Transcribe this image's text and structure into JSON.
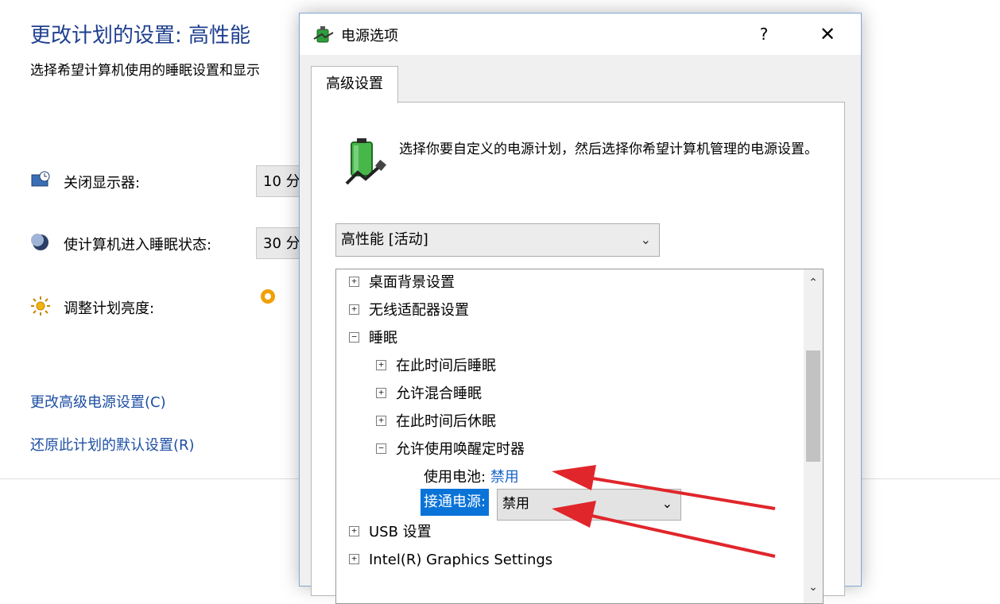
{
  "background_panel": {
    "title": "更改计划的设置: 高性能",
    "description": "选择希望计算机使用的睡眠设置和显示",
    "rows": [
      {
        "label": "关闭显示器:",
        "value": "10 分",
        "icon": "monitor-icon"
      },
      {
        "label": "使计算机进入睡眠状态:",
        "value": "30 分",
        "icon": "moon-icon"
      },
      {
        "label": "调整计划亮度:",
        "icon": "sun-icon"
      }
    ],
    "links": [
      "更改高级电源设置(C)",
      "还原此计划的默认设置(R)"
    ]
  },
  "dialog": {
    "title": "电源选项",
    "help": "?",
    "close": "✕",
    "tab": "高级设置",
    "description": "选择你要自定义的电源计划，然后选择你希望计算机管理的电源设置。",
    "plan_select": "高性能 [活动]",
    "tree": {
      "nodes": [
        {
          "label": "桌面背景设置",
          "expander": "+"
        },
        {
          "label": "无线适配器设置",
          "expander": "+"
        },
        {
          "label": "睡眠",
          "expander": "−"
        },
        {
          "label": "在此时间后睡眠",
          "expander": "+"
        },
        {
          "label": "允许混合睡眠",
          "expander": "+"
        },
        {
          "label": "在此时间后休眠",
          "expander": "+"
        },
        {
          "label": "允许使用唤醒定时器",
          "expander": "−"
        },
        {
          "label": "USB 设置",
          "expander": "+"
        },
        {
          "label": "Intel(R) Graphics Settings",
          "expander": "+"
        }
      ],
      "battery_setting": {
        "label": "使用电池:",
        "value": "禁用"
      },
      "ac_setting": {
        "label": "接通电源:",
        "value": "禁用"
      }
    }
  },
  "colors": {
    "accent": "#0a73d8",
    "link": "#1e4fa3",
    "arrow": "#e0262b"
  }
}
